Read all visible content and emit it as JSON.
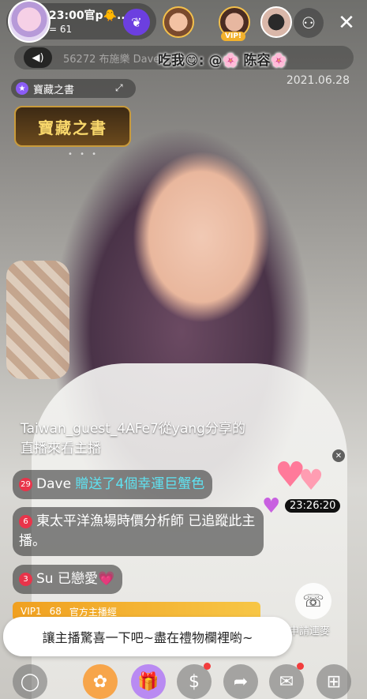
{
  "header": {
    "host_name": "23:00官p🐥..",
    "viewer_count": "= 61",
    "follow_icon": "wings-icon",
    "vip_label": "VIP!",
    "account_icon": "user-switch-icon",
    "close_icon": "close-icon"
  },
  "marquee": {
    "speaker_icon": "speaker-icon",
    "ghost_text": "56272   布施樂   Dave",
    "text": "吃我😋: @🌸 陈容🌸",
    "date": "2021.06.28"
  },
  "treasure": {
    "label": "寶藏之書",
    "logo_text": "寶藏之書"
  },
  "chat": {
    "share_message": "Taiwan_guest_4AFe7從yang分享的直播來看主播",
    "messages": [
      {
        "level": "29",
        "user": "Dave",
        "text": " 贈送了4個幸運巨蟹色"
      },
      {
        "level": "6",
        "user": "東太平洋漁場時價分析師",
        "text": " 已追蹤此主播。"
      },
      {
        "level": "3",
        "user": "Su",
        "text": " 已戀愛💗"
      }
    ]
  },
  "effects": {
    "timer": "23:26:20"
  },
  "vip_bar": {
    "vip": "VIP1",
    "count": "68",
    "title": "官方主播經"
  },
  "tooltip": {
    "text": "讓主播驚喜一下吧~盡在禮物欄裡喲~"
  },
  "call": {
    "label": "申請連麥"
  },
  "toolbar": {
    "items": [
      "chat-bubble-icon",
      "lotus-icon",
      "gift-icon",
      "money-bag-icon",
      "share-icon",
      "mail-icon",
      "grid-icon"
    ]
  }
}
